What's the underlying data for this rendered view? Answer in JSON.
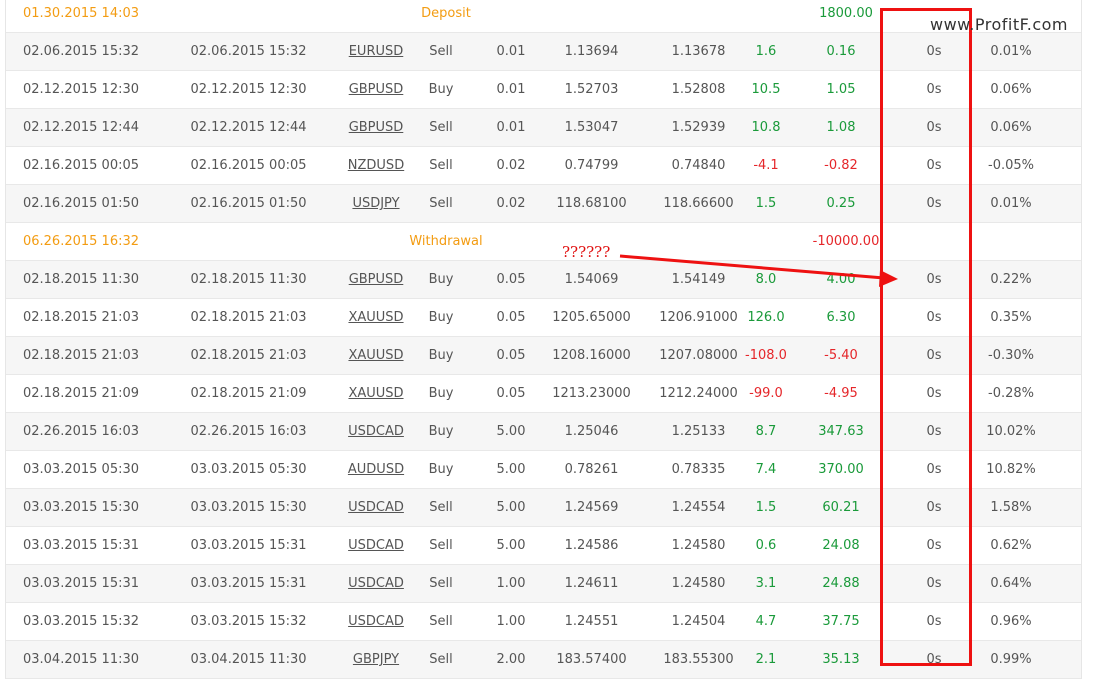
{
  "watermark": "www.ProfitF.com",
  "annotation": "??????",
  "colors": {
    "accent": "#f39c12",
    "loss": "#e5262a",
    "profit": "#1a9a3a",
    "highlight": "#ee1111"
  },
  "rows": [
    {
      "kind": "balance",
      "date": "01.30.2015 14:03",
      "label": "Deposit",
      "amount": "1800.00",
      "amount_color": "green"
    },
    {
      "kind": "trade",
      "open": "02.06.2015 15:32",
      "close": "02.06.2015 15:32",
      "symbol": "EURUSD",
      "type": "Sell",
      "lots": "0.01",
      "open_price": "1.13694",
      "close_price": "1.13678",
      "pips": "1.6",
      "profit": "0.16",
      "duration": "0s",
      "gain": "0.01%",
      "sign": "pos"
    },
    {
      "kind": "trade",
      "open": "02.12.2015 12:30",
      "close": "02.12.2015 12:30",
      "symbol": "GBPUSD",
      "type": "Buy",
      "lots": "0.01",
      "open_price": "1.52703",
      "close_price": "1.52808",
      "pips": "10.5",
      "profit": "1.05",
      "duration": "0s",
      "gain": "0.06%",
      "sign": "pos"
    },
    {
      "kind": "trade",
      "open": "02.12.2015 12:44",
      "close": "02.12.2015 12:44",
      "symbol": "GBPUSD",
      "type": "Sell",
      "lots": "0.01",
      "open_price": "1.53047",
      "close_price": "1.52939",
      "pips": "10.8",
      "profit": "1.08",
      "duration": "0s",
      "gain": "0.06%",
      "sign": "pos"
    },
    {
      "kind": "trade",
      "open": "02.16.2015 00:05",
      "close": "02.16.2015 00:05",
      "symbol": "NZDUSD",
      "type": "Sell",
      "lots": "0.02",
      "open_price": "0.74799",
      "close_price": "0.74840",
      "pips": "-4.1",
      "profit": "-0.82",
      "duration": "0s",
      "gain": "-0.05%",
      "sign": "neg"
    },
    {
      "kind": "trade",
      "open": "02.16.2015 01:50",
      "close": "02.16.2015 01:50",
      "symbol": "USDJPY",
      "type": "Sell",
      "lots": "0.02",
      "open_price": "118.68100",
      "close_price": "118.66600",
      "pips": "1.5",
      "profit": "0.25",
      "duration": "0s",
      "gain": "0.01%",
      "sign": "pos"
    },
    {
      "kind": "balance",
      "date": "06.26.2015 16:32",
      "label": "Withdrawal",
      "amount": "-10000.00",
      "amount_color": "red"
    },
    {
      "kind": "trade",
      "open": "02.18.2015 11:30",
      "close": "02.18.2015 11:30",
      "symbol": "GBPUSD",
      "type": "Buy",
      "lots": "0.05",
      "open_price": "1.54069",
      "close_price": "1.54149",
      "pips": "8.0",
      "profit": "4.00",
      "duration": "0s",
      "gain": "0.22%",
      "sign": "pos"
    },
    {
      "kind": "trade",
      "open": "02.18.2015 21:03",
      "close": "02.18.2015 21:03",
      "symbol": "XAUUSD",
      "type": "Buy",
      "lots": "0.05",
      "open_price": "1205.65000",
      "close_price": "1206.91000",
      "pips": "126.0",
      "profit": "6.30",
      "duration": "0s",
      "gain": "0.35%",
      "sign": "pos"
    },
    {
      "kind": "trade",
      "open": "02.18.2015 21:03",
      "close": "02.18.2015 21:03",
      "symbol": "XAUUSD",
      "type": "Buy",
      "lots": "0.05",
      "open_price": "1208.16000",
      "close_price": "1207.08000",
      "pips": "-108.0",
      "profit": "-5.40",
      "duration": "0s",
      "gain": "-0.30%",
      "sign": "neg"
    },
    {
      "kind": "trade",
      "open": "02.18.2015 21:09",
      "close": "02.18.2015 21:09",
      "symbol": "XAUUSD",
      "type": "Buy",
      "lots": "0.05",
      "open_price": "1213.23000",
      "close_price": "1212.24000",
      "pips": "-99.0",
      "profit": "-4.95",
      "duration": "0s",
      "gain": "-0.28%",
      "sign": "neg"
    },
    {
      "kind": "trade",
      "open": "02.26.2015 16:03",
      "close": "02.26.2015 16:03",
      "symbol": "USDCAD",
      "type": "Buy",
      "lots": "5.00",
      "open_price": "1.25046",
      "close_price": "1.25133",
      "pips": "8.7",
      "profit": "347.63",
      "duration": "0s",
      "gain": "10.02%",
      "sign": "pos"
    },
    {
      "kind": "trade",
      "open": "03.03.2015 05:30",
      "close": "03.03.2015 05:30",
      "symbol": "AUDUSD",
      "type": "Buy",
      "lots": "5.00",
      "open_price": "0.78261",
      "close_price": "0.78335",
      "pips": "7.4",
      "profit": "370.00",
      "duration": "0s",
      "gain": "10.82%",
      "sign": "pos"
    },
    {
      "kind": "trade",
      "open": "03.03.2015 15:30",
      "close": "03.03.2015 15:30",
      "symbol": "USDCAD",
      "type": "Sell",
      "lots": "5.00",
      "open_price": "1.24569",
      "close_price": "1.24554",
      "pips": "1.5",
      "profit": "60.21",
      "duration": "0s",
      "gain": "1.58%",
      "sign": "pos"
    },
    {
      "kind": "trade",
      "open": "03.03.2015 15:31",
      "close": "03.03.2015 15:31",
      "symbol": "USDCAD",
      "type": "Sell",
      "lots": "5.00",
      "open_price": "1.24586",
      "close_price": "1.24580",
      "pips": "0.6",
      "profit": "24.08",
      "duration": "0s",
      "gain": "0.62%",
      "sign": "pos"
    },
    {
      "kind": "trade",
      "open": "03.03.2015 15:31",
      "close": "03.03.2015 15:31",
      "symbol": "USDCAD",
      "type": "Sell",
      "lots": "1.00",
      "open_price": "1.24611",
      "close_price": "1.24580",
      "pips": "3.1",
      "profit": "24.88",
      "duration": "0s",
      "gain": "0.64%",
      "sign": "pos"
    },
    {
      "kind": "trade",
      "open": "03.03.2015 15:32",
      "close": "03.03.2015 15:32",
      "symbol": "USDCAD",
      "type": "Sell",
      "lots": "1.00",
      "open_price": "1.24551",
      "close_price": "1.24504",
      "pips": "4.7",
      "profit": "37.75",
      "duration": "0s",
      "gain": "0.96%",
      "sign": "pos"
    },
    {
      "kind": "trade",
      "open": "03.04.2015 11:30",
      "close": "03.04.2015 11:30",
      "symbol": "GBPJPY",
      "type": "Sell",
      "lots": "2.00",
      "open_price": "183.57400",
      "close_price": "183.55300",
      "pips": "2.1",
      "profit": "35.13",
      "duration": "0s",
      "gain": "0.99%",
      "sign": "pos"
    }
  ]
}
